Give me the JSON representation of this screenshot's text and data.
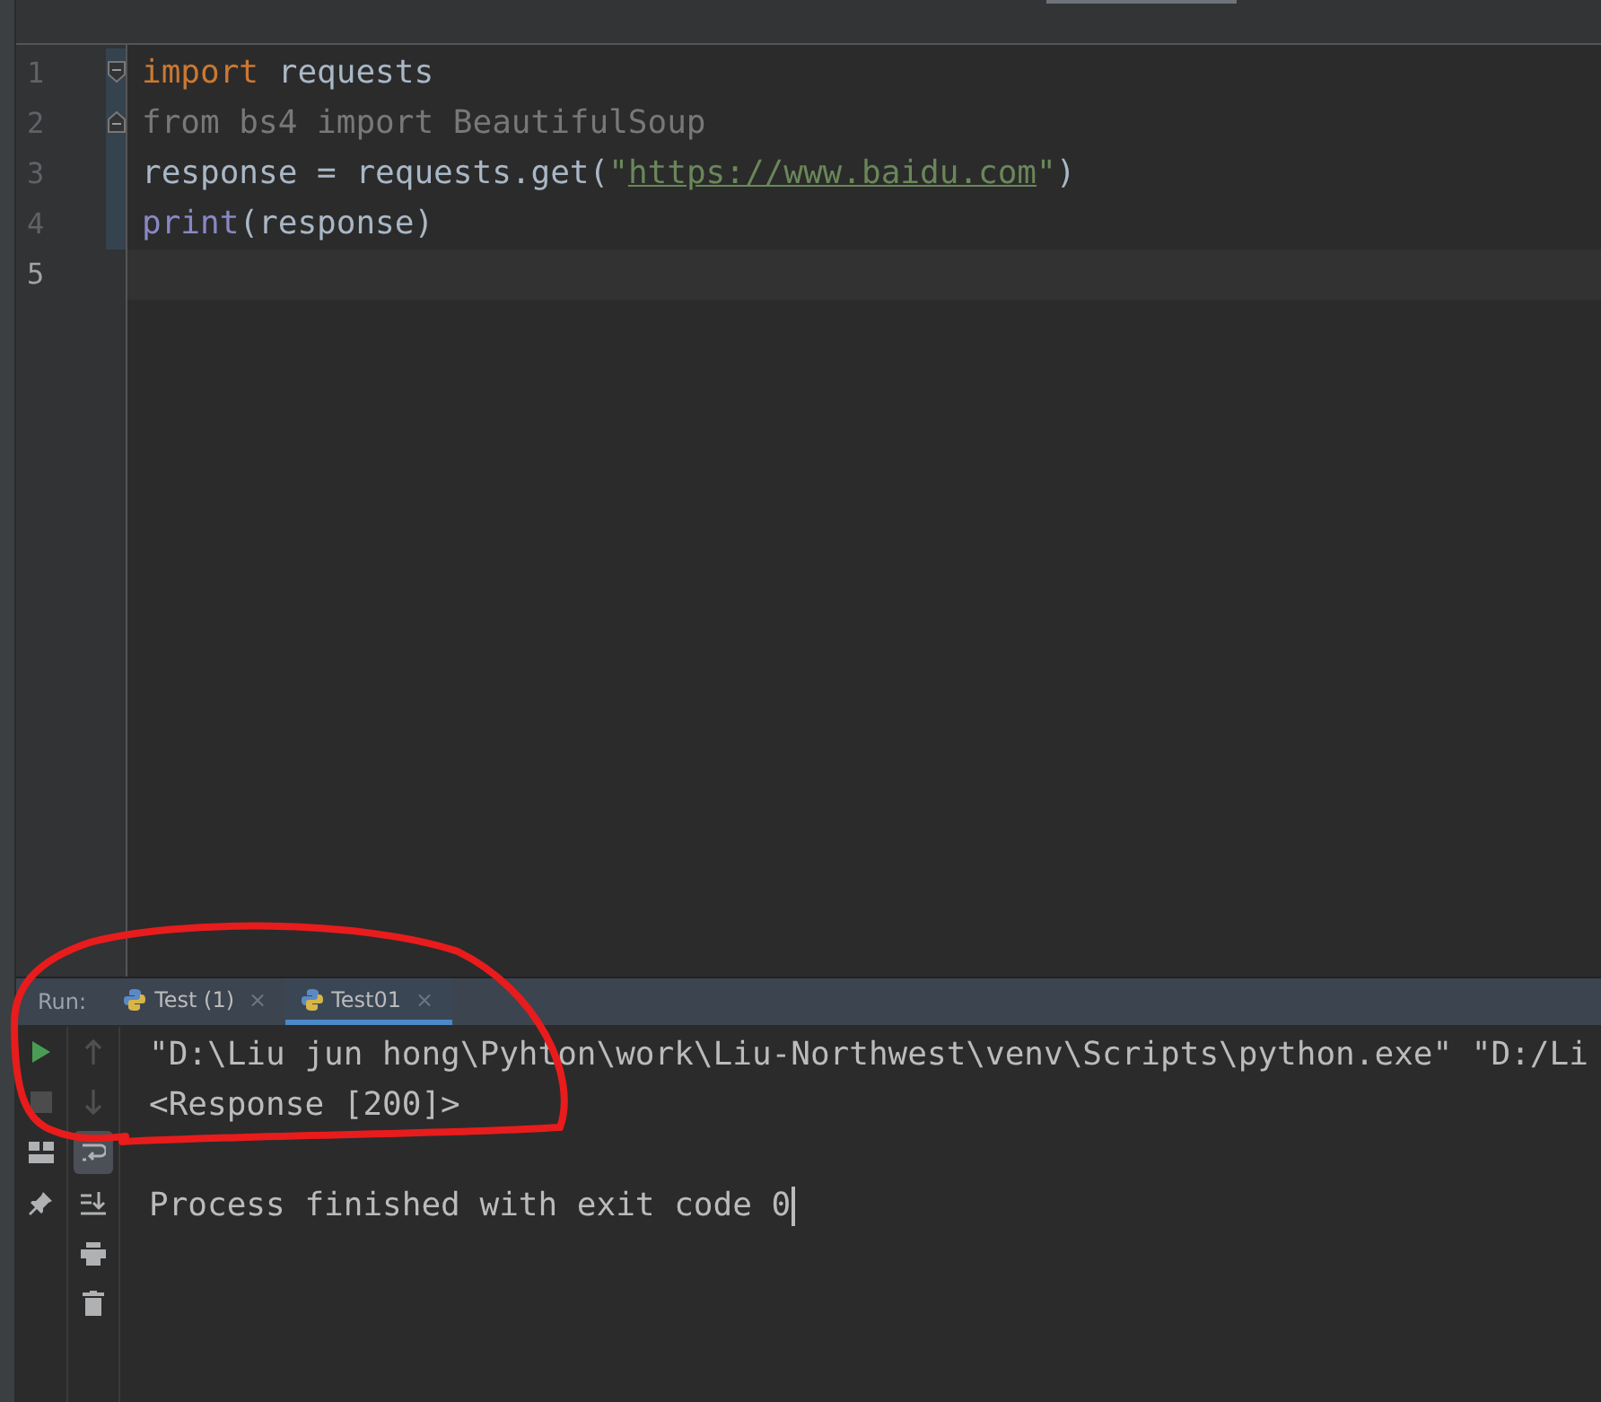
{
  "editor": {
    "lines": [
      {
        "number": "1",
        "fold_start": true,
        "fold_end": false,
        "in_block": true,
        "current": false,
        "tokens": [
          {
            "kind": "keyword",
            "text": "import"
          },
          {
            "kind": "plain",
            "text": " requests"
          }
        ]
      },
      {
        "number": "2",
        "fold_start": false,
        "fold_end": true,
        "in_block": true,
        "current": false,
        "tokens": [
          {
            "kind": "unused",
            "text": "from bs4 import BeautifulSoup"
          }
        ]
      },
      {
        "number": "3",
        "fold_start": false,
        "fold_end": false,
        "in_block": true,
        "current": false,
        "tokens": [
          {
            "kind": "plain",
            "text": "response = requests.get("
          },
          {
            "kind": "string",
            "text": "\""
          },
          {
            "kind": "url",
            "text": "https://www.baidu.com"
          },
          {
            "kind": "string",
            "text": "\""
          },
          {
            "kind": "plain",
            "text": ")"
          }
        ]
      },
      {
        "number": "4",
        "fold_start": false,
        "fold_end": false,
        "in_block": true,
        "current": false,
        "tokens": [
          {
            "kind": "builtin",
            "text": "print"
          },
          {
            "kind": "plain",
            "text": "(response)"
          }
        ]
      },
      {
        "number": "5",
        "fold_start": false,
        "fold_end": false,
        "in_block": false,
        "current": true
      }
    ]
  },
  "run_panel": {
    "label": "Run:",
    "tabs": [
      {
        "label": "Test (1)",
        "close": "×",
        "selected": false
      },
      {
        "label": "Test01",
        "close": "×",
        "selected": true
      }
    ],
    "left_toolbar": [
      {
        "disabled": false
      },
      {
        "disabled": true
      },
      {
        "disabled": false
      },
      {
        "disabled": false
      }
    ],
    "right_toolbar": [
      {
        "disabled": true,
        "on": false
      },
      {
        "disabled": true,
        "on": false
      },
      {
        "disabled": false,
        "on": true
      },
      {
        "disabled": false,
        "on": false
      },
      {
        "disabled": false,
        "on": false
      },
      {
        "disabled": false,
        "on": false
      }
    ],
    "console": [
      {
        "text": "\"D:\\Liu jun hong\\Pyhton\\work\\Liu-Northwest\\venv\\Scripts\\python.exe\" \"D:/Li",
        "gap_before": false,
        "cursor": false
      },
      {
        "text": "<Response [200]>",
        "gap_before": false,
        "cursor": false
      },
      {
        "text": "Process finished with exit code 0",
        "gap_before": true,
        "cursor": true
      }
    ]
  }
}
